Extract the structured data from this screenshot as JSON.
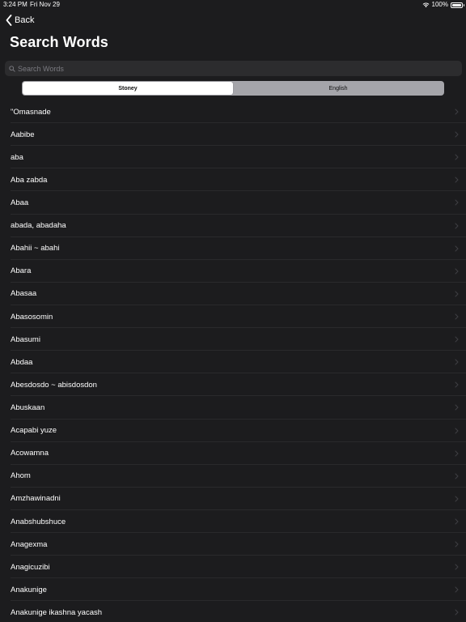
{
  "status_bar": {
    "time": "3:24 PM",
    "date": "Fri Nov 29",
    "battery": "100%",
    "wifi_icon": "wifi-icon",
    "battery_icon": "battery-icon"
  },
  "nav": {
    "back_label": "Back",
    "back_icon": "chevron-left-icon",
    "title": "Search Words"
  },
  "search": {
    "placeholder": "Search Words",
    "value": "",
    "icon": "search-icon"
  },
  "segmented_control": {
    "segments": [
      "Stoney",
      "English"
    ],
    "selected": "Stoney"
  },
  "words": [
    "\"Omasnade",
    "Aabibe",
    "aba",
    "Aba zabda",
    "Abaa",
    "abada, abadaha",
    "Abahii ~ abahi",
    "Abara",
    "Abasaa",
    "Abasosomin",
    "Abasumi",
    "Abdaa",
    "Abesdosdo ~ abisdosdon",
    "Abuskaan",
    "Acapabi yuze",
    "Acowamna",
    "Ahom",
    "Amzhawinadni",
    "Anabshubshuce",
    "Anagexma",
    "Anagicuzibi",
    "Anakunige",
    "Anakunige ikashna yacash"
  ],
  "colors": {
    "background": "#1c1c1e",
    "search_field": "#2c2c2e",
    "separator": "#2a2a2c",
    "segment_track": "#a5a5aa",
    "segment_selected": "#ffffff",
    "text": "#ffffff",
    "placeholder": "#7a7a80"
  },
  "row_icon": "chevron-right-icon"
}
